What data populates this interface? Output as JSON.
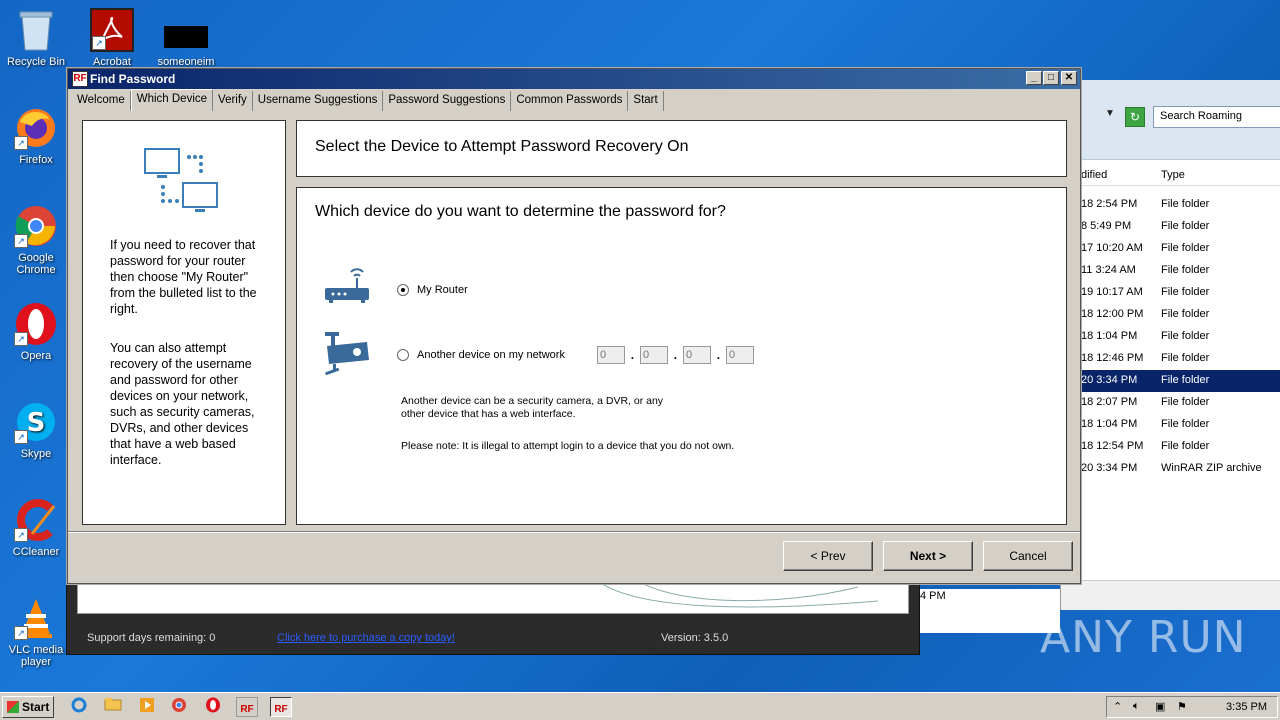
{
  "desktop": {
    "icons": [
      {
        "label": "Recycle Bin"
      },
      {
        "label": "Acrobat"
      },
      {
        "label": "someoneim"
      },
      {
        "label": "Firefox"
      },
      {
        "label": "Google Chrome"
      },
      {
        "label": "Opera"
      },
      {
        "label": "Skype"
      },
      {
        "label": "CCleaner"
      },
      {
        "label": "VLC media player"
      }
    ]
  },
  "explorer": {
    "search_placeholder": "Search Roaming",
    "columns": [
      "dified",
      "Type"
    ],
    "rows": [
      {
        "modified": "18 2:54 PM",
        "type": "File folder"
      },
      {
        "modified": "8 5:49 PM",
        "type": "File folder"
      },
      {
        "modified": "17 10:20 AM",
        "type": "File folder"
      },
      {
        "modified": "11 3:24 AM",
        "type": "File folder"
      },
      {
        "modified": "19 10:17 AM",
        "type": "File folder"
      },
      {
        "modified": "18 12:00 PM",
        "type": "File folder"
      },
      {
        "modified": "18 1:04 PM",
        "type": "File folder"
      },
      {
        "modified": "18 12:46 PM",
        "type": "File folder"
      },
      {
        "modified": "20 3:34 PM",
        "type": "File folder",
        "selected": true
      },
      {
        "modified": "18 2:07 PM",
        "type": "File folder"
      },
      {
        "modified": "18 1:04 PM",
        "type": "File folder"
      },
      {
        "modified": "18 12:54 PM",
        "type": "File folder"
      },
      {
        "modified": "20 3:34 PM",
        "type": "WinRAR ZIP archive"
      }
    ],
    "bottom_time": "4 PM"
  },
  "background_app": {
    "support_days": "Support days remaining: 0",
    "purchase_link": "Click here to purchase a copy today!",
    "version": "Version: 3.5.0"
  },
  "dialog": {
    "title": "Find Password",
    "tabs": [
      "Welcome",
      "Which Device",
      "Verify",
      "Username Suggestions",
      "Password Suggestions",
      "Common Passwords",
      "Start"
    ],
    "active_tab": "Which Device",
    "left_text_1": "If you need to recover that password for your router then choose \"My Router\" from the bulleted list to the right.",
    "left_text_2": "You can also attempt recovery of the username and password for other devices on your network, such as security cameras, DVRs, and other devices that have a web based interface.",
    "header_title": "Select the Device to Attempt Password Recovery On",
    "question": "Which device do you want to determine the password for?",
    "option_router": "My Router",
    "option_other": "Another device on my network",
    "selected_option": "My Router",
    "ip_placeholders": [
      "0",
      "0",
      "0",
      "0"
    ],
    "ip_dot": ".",
    "note_1_line1": "Another device can be a security camera, a DVR, or any",
    "note_1_line2": "other device that has a web interface.",
    "note_2": "Please note: It is illegal to attempt login to a device that you do not own.",
    "buttons": {
      "prev": "< Prev",
      "next": "Next >",
      "cancel": "Cancel"
    }
  },
  "taskbar": {
    "start_label": "Start",
    "clock": "3:35 PM"
  },
  "watermark": "ANY RUN"
}
